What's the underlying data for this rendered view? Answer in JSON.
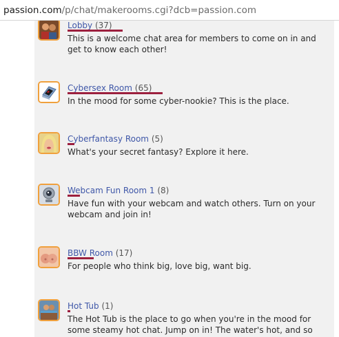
{
  "browser": {
    "url_host": "passion.com",
    "url_path": "/p/chat/makerooms.cgi?dcb=passion.com"
  },
  "accent_color": "#9c1f3e",
  "link_color": "#3f57a8",
  "rooms": [
    {
      "name": "Lobby",
      "count": "(37)",
      "icon": "lobby-people-icon",
      "description": "This is a welcome chat area for members to come on in and get to know each other!"
    },
    {
      "name": "Cybersex Room",
      "count": "(65)",
      "icon": "laptop-icon",
      "description": "In the mood for some cyber-nookie? This is the place."
    },
    {
      "name": "Cyberfantasy Room",
      "count": "(5)",
      "icon": "blonde-woman-icon",
      "description": "What's your secret fantasy? Explore it here."
    },
    {
      "name": "Webcam Fun Room 1",
      "count": "(8)",
      "icon": "webcam-icon",
      "description": "Have fun with your webcam and watch others. Turn on your webcam and join in!"
    },
    {
      "name": "BBW Room",
      "count": "(17)",
      "icon": "bbw-icon",
      "description": "For people who think big, love big, want big."
    },
    {
      "name": "Hot Tub",
      "count": "(1)",
      "icon": "hot-tub-icon",
      "description": "The Hot Tub is the place to go when you're in the mood for some steamy hot chat. Jump on in! The water's hot, and so"
    }
  ]
}
